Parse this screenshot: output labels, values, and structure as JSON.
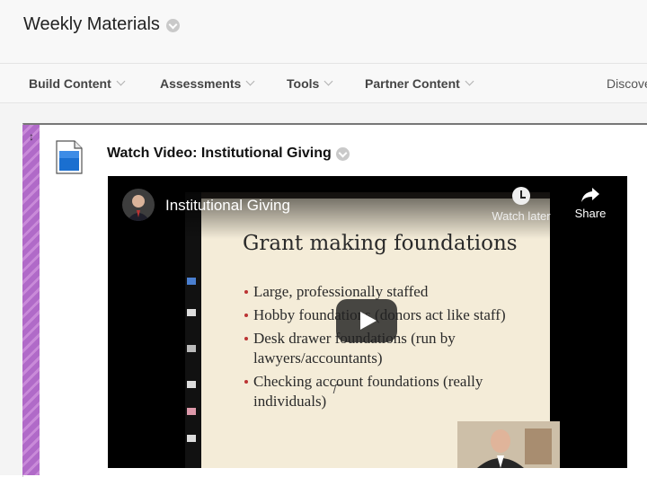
{
  "page": {
    "title": "Weekly Materials"
  },
  "toolbar": {
    "items": [
      {
        "label": "Build Content"
      },
      {
        "label": "Assessments"
      },
      {
        "label": "Tools"
      },
      {
        "label": "Partner Content"
      }
    ],
    "discover_label": "Discove"
  },
  "content_item": {
    "title": "Watch Video: Institutional Giving",
    "icon": "document-icon",
    "accent_color": "#b06ac8"
  },
  "video": {
    "title": "Institutional Giving",
    "watch_later_label": "Watch later",
    "share_label": "Share",
    "slide": {
      "heading": "Grant making foundations",
      "bullets": [
        "Large, professionally staffed",
        "Hobby foundations (donors act like staff)",
        "Desk drawer  foundations (run by lawyers/accountants)",
        "Checking account foundations (really individuals)"
      ]
    }
  }
}
